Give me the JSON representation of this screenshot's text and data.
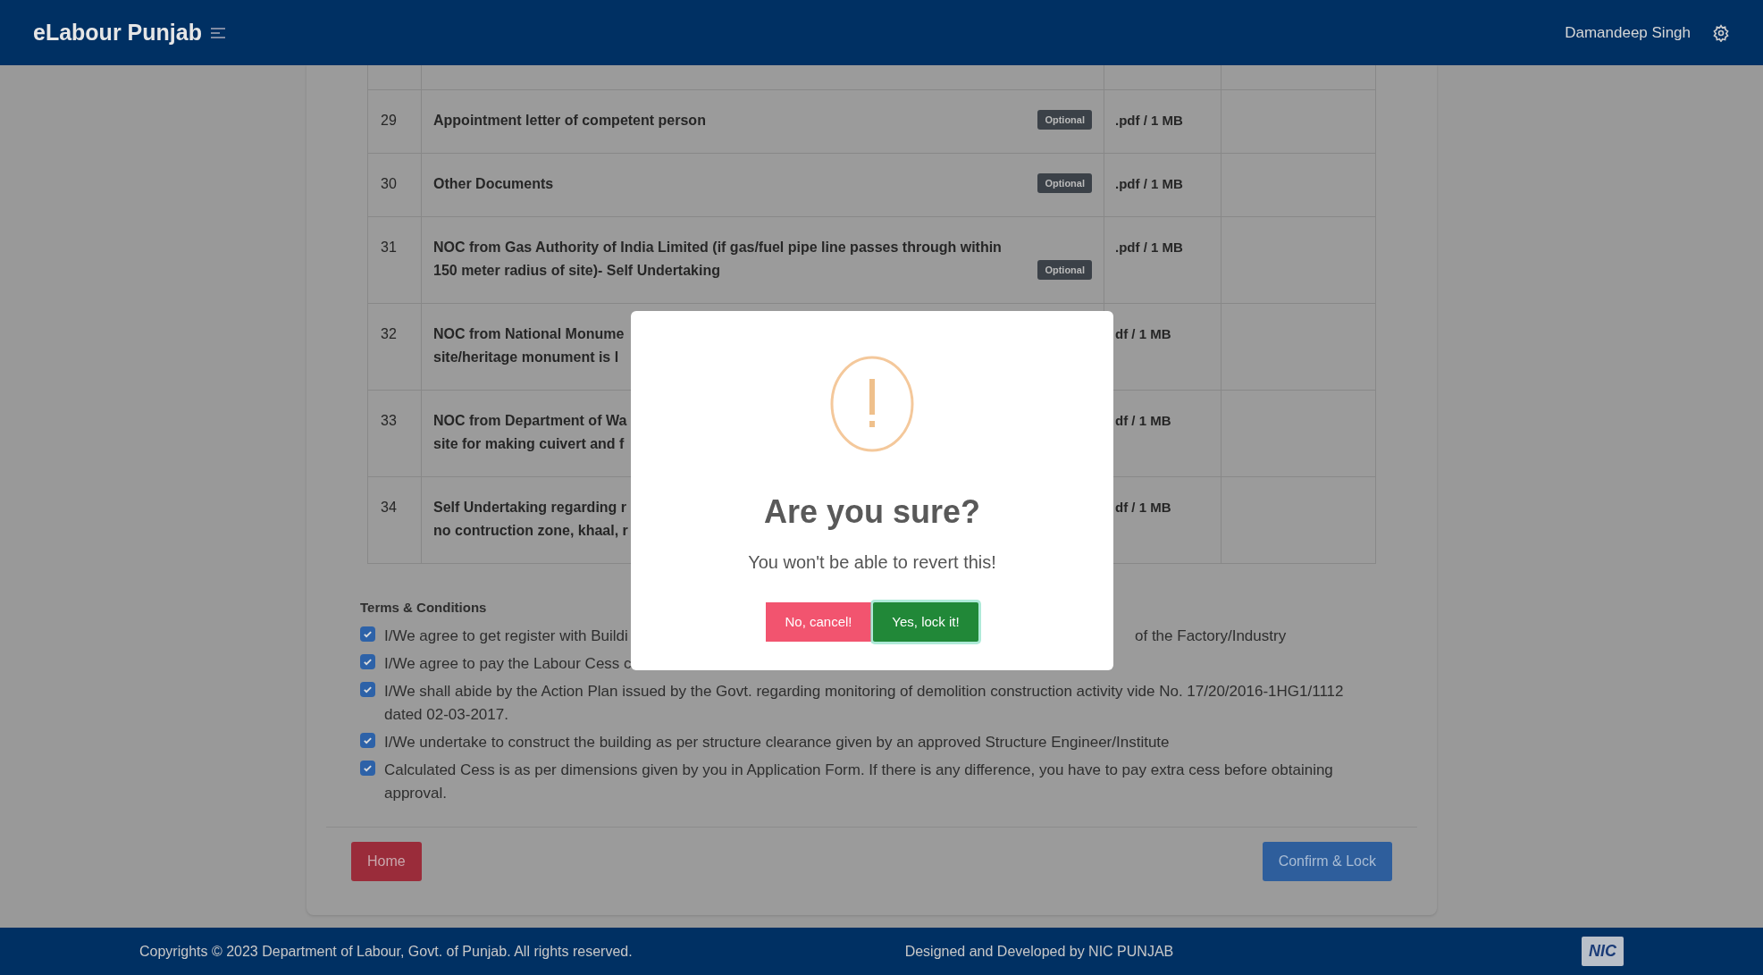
{
  "header": {
    "brand": "eLabour Punjab",
    "user": "Damandeep Singh"
  },
  "documents": [
    {
      "number": "29",
      "description": "Appointment letter of competent person",
      "badge": "Optional",
      "format": ".pdf / 1 MB"
    },
    {
      "number": "30",
      "description": "Other Documents",
      "badge": "Optional",
      "format": ".pdf / 1 MB"
    },
    {
      "number": "31",
      "description": "NOC from Gas Authority of India Limited (if gas/fuel pipe line passes through within 150 meter radius of site)- Self Undertaking",
      "badge": "Optional",
      "format": ".pdf / 1 MB"
    },
    {
      "number": "32",
      "description_fragments": [
        "NOC from National Monume",
        "site/heritage monument is l"
      ],
      "format": "df / 1 MB"
    },
    {
      "number": "33",
      "description_fragments": [
        "NOC from Department of Wa",
        "site for making cuivert and f"
      ],
      "format": "df / 1 MB"
    },
    {
      "number": "34",
      "description_fragments": [
        "Self Undertaking regarding r",
        "no contruction zone, khaal, r"
      ],
      "format": "df / 1 MB"
    }
  ],
  "terms": {
    "title": "Terms & Conditions",
    "items": [
      {
        "checked": true,
        "text": "I/We agree to get register with Buildi",
        "text_after": "of the Factory/Industry"
      },
      {
        "checked": true,
        "text": "I/We agree to pay the Labour Cess c"
      },
      {
        "checked": true,
        "text": "I/We shall abide by the Action Plan issued by the Govt. regarding monitoring of demolition construction activity vide No. 17/20/2016-1HG1/1112 dated 02-03-2017."
      },
      {
        "checked": true,
        "text": "I/We undertake to construct the building as per structure clearance given by an approved Structure Engineer/Institute"
      },
      {
        "checked": true,
        "text": "Calculated Cess is as per dimensions given by you in Application Form. If there is any difference, you have to pay extra cess before obtaining approval."
      }
    ]
  },
  "actions": {
    "home": "Home",
    "confirm": "Confirm & Lock"
  },
  "dialog": {
    "title": "Are you sure?",
    "message": "You won't be able to revert this!",
    "cancel": "No, cancel!",
    "confirm": "Yes, lock it!"
  },
  "footer": {
    "copyright": "Copyrights © 2023 Department of Labour, Govt. of Punjab. All rights reserved.",
    "credit": "Designed and Developed by NIC PUNJAB",
    "logo_text": "NIC"
  }
}
